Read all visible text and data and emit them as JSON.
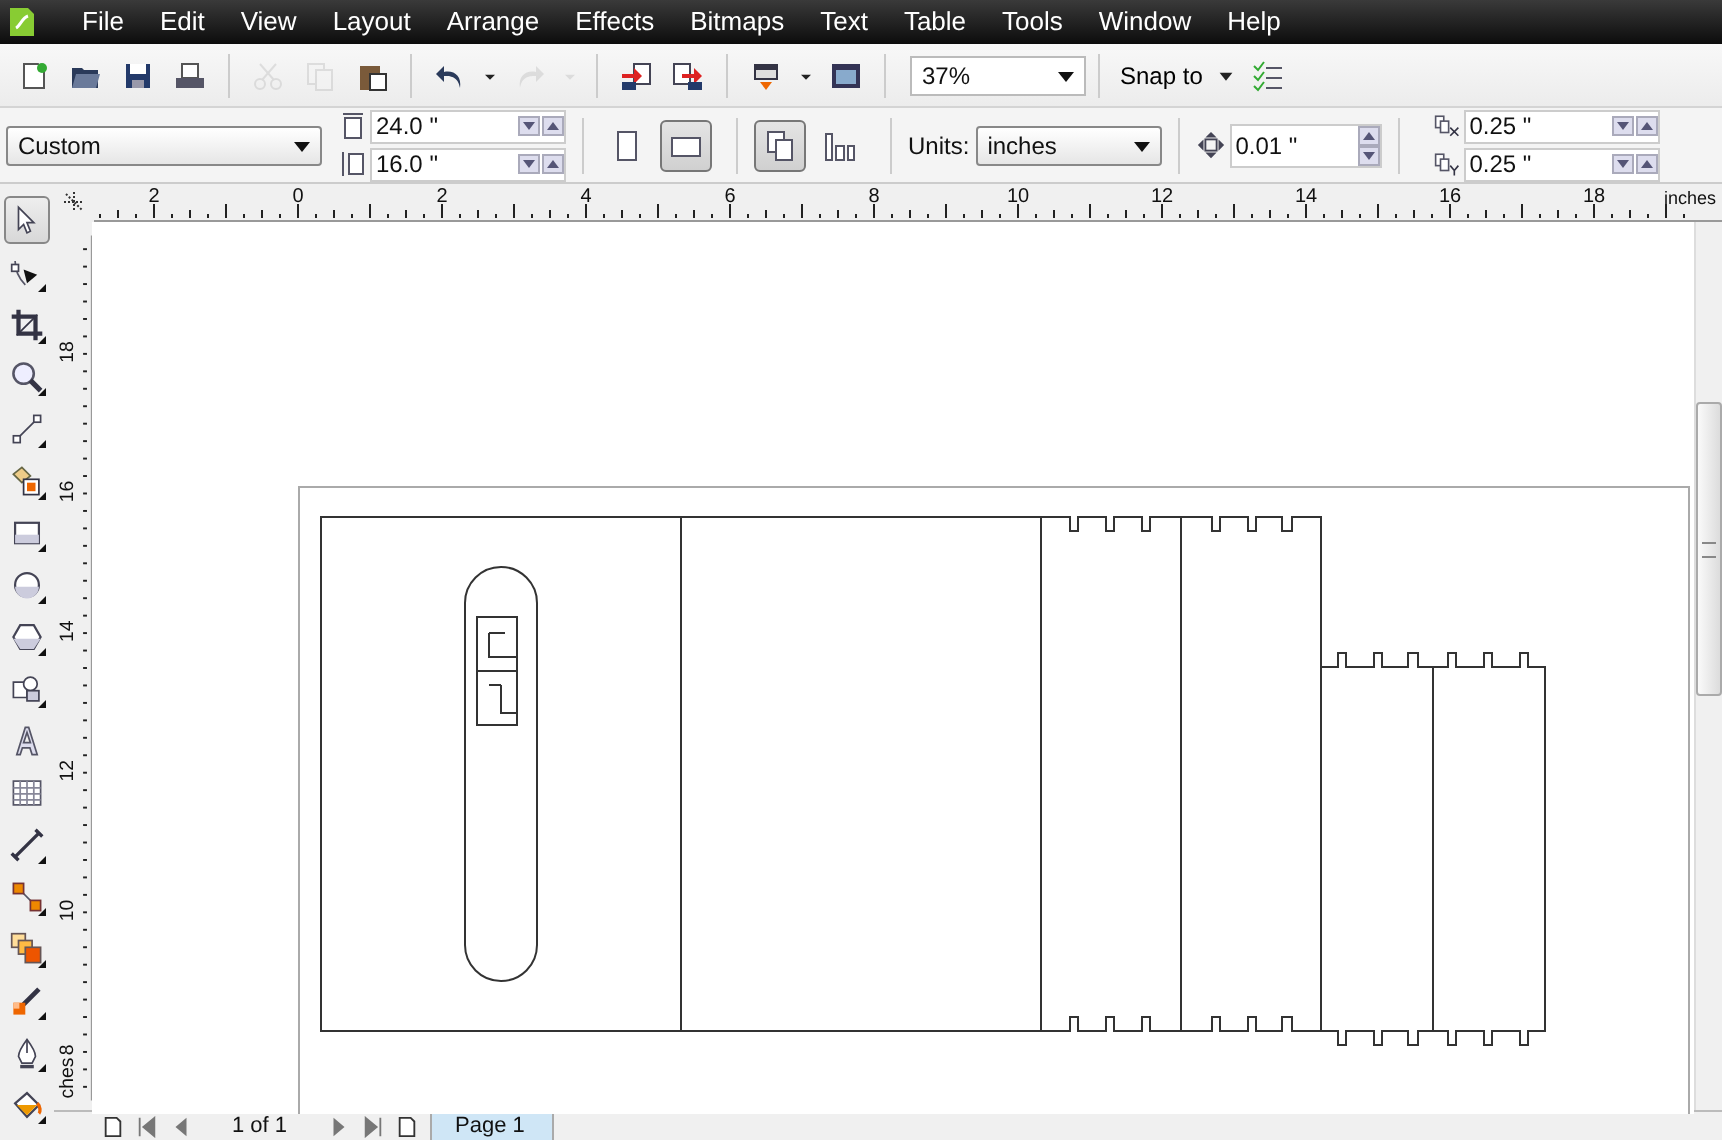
{
  "menu": [
    "File",
    "Edit",
    "View",
    "Layout",
    "Arrange",
    "Effects",
    "Bitmaps",
    "Text",
    "Table",
    "Tools",
    "Window",
    "Help"
  ],
  "standard_toolbar": [
    {
      "kind": "new",
      "disabled": false
    },
    {
      "kind": "open",
      "disabled": false
    },
    {
      "kind": "save",
      "disabled": false
    },
    {
      "kind": "print",
      "disabled": false
    },
    {
      "kind": "separator"
    },
    {
      "kind": "cut",
      "disabled": true
    },
    {
      "kind": "copy",
      "disabled": true
    },
    {
      "kind": "paste",
      "disabled": false
    },
    {
      "kind": "separator"
    },
    {
      "kind": "undo",
      "disabled": false
    },
    {
      "kind": "dropdown",
      "disabled": false
    },
    {
      "kind": "redo",
      "disabled": true
    },
    {
      "kind": "dropdown",
      "disabled": true
    },
    {
      "kind": "separator"
    },
    {
      "kind": "import",
      "disabled": false
    },
    {
      "kind": "export",
      "disabled": false
    },
    {
      "kind": "separator"
    },
    {
      "kind": "launcher",
      "disabled": false
    },
    {
      "kind": "dropdown",
      "disabled": false
    },
    {
      "kind": "welcome",
      "disabled": false
    },
    {
      "kind": "separator"
    }
  ],
  "zoom_level": "37%",
  "snap_to": "Snap to",
  "property_bar": {
    "paper_type": "Custom",
    "width": "24.0 \"",
    "height": "16.0 \"",
    "orientation": [
      {
        "kind": "portrait",
        "selected": false
      },
      {
        "kind": "landscape",
        "selected": true
      }
    ],
    "page_layout": [
      {
        "kind": "all-pages",
        "selected": true
      },
      {
        "kind": "current-page",
        "selected": false
      }
    ],
    "units_label": "Units:",
    "units": "inches",
    "nudge": "0.01 \"",
    "duplicate_x": "0.25 \"",
    "duplicate_y": "0.25 \""
  },
  "horizontal_ruler": {
    "labels": [
      "2",
      "0",
      "2",
      "4",
      "6",
      "8",
      "10",
      "12",
      "14",
      "16",
      "18"
    ],
    "unit": "inches"
  },
  "vertical_ruler": {
    "labels": [
      "18",
      "16",
      "14",
      "12",
      "10",
      "8"
    ],
    "unit": "ches"
  },
  "tools": [
    {
      "kind": "pick",
      "selected": true,
      "flyout": false
    },
    {
      "kind": "shape",
      "selected": false,
      "flyout": true
    },
    {
      "kind": "crop",
      "selected": false,
      "flyout": true
    },
    {
      "kind": "zoom",
      "selected": false,
      "flyout": true
    },
    {
      "kind": "curve",
      "selected": false,
      "flyout": true
    },
    {
      "kind": "smartfill",
      "selected": false,
      "flyout": true
    },
    {
      "kind": "rectangle",
      "selected": false,
      "flyout": true
    },
    {
      "kind": "ellipse",
      "selected": false,
      "flyout": true
    },
    {
      "kind": "polygon",
      "selected": false,
      "flyout": true
    },
    {
      "kind": "basicshapes",
      "selected": false,
      "flyout": true
    },
    {
      "kind": "text",
      "selected": false,
      "flyout": false
    },
    {
      "kind": "table",
      "selected": false,
      "flyout": false
    },
    {
      "kind": "dimension",
      "selected": false,
      "flyout": true
    },
    {
      "kind": "connector",
      "selected": false,
      "flyout": true
    },
    {
      "kind": "blend",
      "selected": false,
      "flyout": true
    },
    {
      "kind": "eyedropper",
      "selected": false,
      "flyout": true
    },
    {
      "kind": "outline",
      "selected": false,
      "flyout": true
    },
    {
      "kind": "fill",
      "selected": false,
      "flyout": true
    }
  ],
  "page_navigator": {
    "count": "1 of 1",
    "tabs": [
      {
        "label": "Page 1",
        "selected": true
      }
    ]
  }
}
